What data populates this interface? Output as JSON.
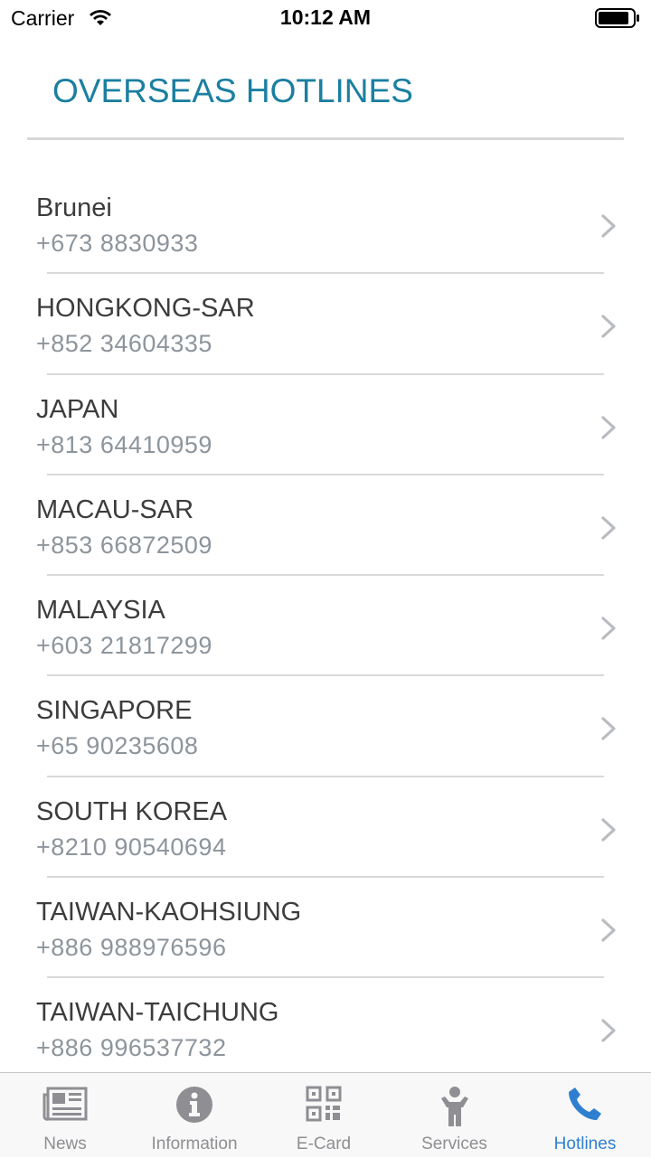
{
  "status_bar": {
    "carrier": "Carrier",
    "time": "10:12 AM"
  },
  "header": {
    "title": "OVERSEAS HOTLINES",
    "title_color": "#1b7fa0"
  },
  "hotlines": [
    {
      "name": "Brunei",
      "phone": "+673 8830933"
    },
    {
      "name": "HONGKONG-SAR",
      "phone": "+852 34604335"
    },
    {
      "name": "JAPAN",
      "phone": "+813 64410959"
    },
    {
      "name": "MACAU-SAR",
      "phone": "+853 66872509"
    },
    {
      "name": "MALAYSIA",
      "phone": "+603 21817299"
    },
    {
      "name": "SINGAPORE",
      "phone": "+65 90235608"
    },
    {
      "name": "SOUTH KOREA",
      "phone": "+8210 90540694"
    },
    {
      "name": "TAIWAN-KAOHSIUNG",
      "phone": "+886 988976596"
    },
    {
      "name": "TAIWAN-TAICHUNG",
      "phone": "+886 996537732"
    }
  ],
  "tabbar": {
    "active_color": "#2f7fd0",
    "inactive_color": "#8e8e93",
    "tabs": [
      {
        "label": "News",
        "icon": "newspaper-icon",
        "active": false
      },
      {
        "label": "Information",
        "icon": "info-icon",
        "active": false
      },
      {
        "label": "E-Card",
        "icon": "qr-code-icon",
        "active": false
      },
      {
        "label": "Services",
        "icon": "person-icon",
        "active": false
      },
      {
        "label": "Hotlines",
        "icon": "phone-icon",
        "active": true
      }
    ]
  }
}
